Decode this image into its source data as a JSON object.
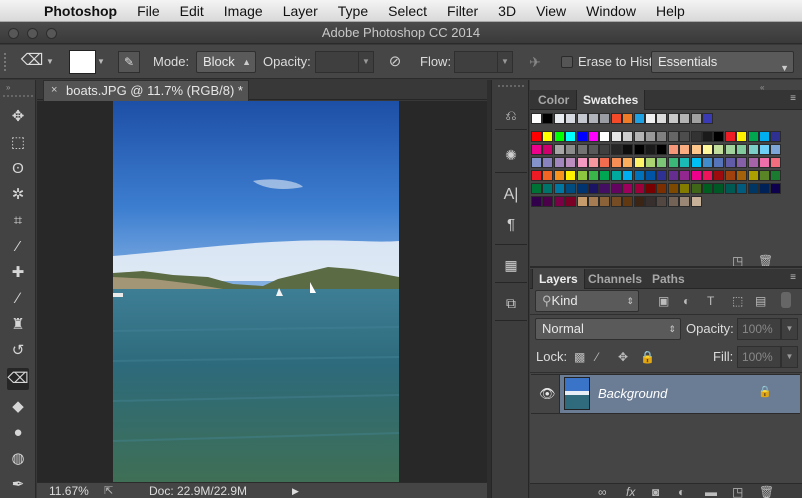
{
  "menubar": {
    "app_name": "Photoshop",
    "items": [
      "File",
      "Edit",
      "Image",
      "Layer",
      "Type",
      "Select",
      "Filter",
      "3D",
      "View",
      "Window",
      "Help"
    ]
  },
  "window": {
    "title": "Adobe Photoshop CC 2014"
  },
  "options": {
    "mode_label": "Mode:",
    "mode_value": "Block",
    "opacity_label": "Opacity:",
    "flow_label": "Flow:",
    "erase_history_label": "Erase to Hist",
    "workspace_value": "Essentials"
  },
  "document": {
    "tab_title": "boats.JPG @ 11.7% (RGB/8) *",
    "zoom": "11.67%",
    "doc_info": "Doc: 22.9M/22.9M"
  },
  "color_panel": {
    "tabs": [
      "Color",
      "Swatches"
    ],
    "active_tab": "Swatches"
  },
  "layers_panel": {
    "tabs": [
      "Layers",
      "Channels",
      "Paths"
    ],
    "filter_value": "Kind",
    "blend_mode": "Normal",
    "opacity_label": "Opacity:",
    "opacity_value": "100%",
    "lock_label": "Lock:",
    "fill_label": "Fill:",
    "fill_value": "100%",
    "layer_name": "Background"
  },
  "colors": {
    "selected_layer": "#6b7d94",
    "panel": "#454545"
  },
  "swatch_rows": [
    [
      "#ffffff",
      "#000000",
      "#e9ecf0",
      "#d6d9df",
      "#c5c8ce",
      "#b0b3ba",
      "#9a9da4",
      "#f44a2a",
      "#ed7b27",
      "#1fa2e4",
      "#f0f0f0",
      "#dcdcdc",
      "#c8c8c8",
      "#b4b4b4",
      "#a0a0a0",
      "#3a3ab4"
    ],
    [
      "#ff0000",
      "#ffff00",
      "#00ff00",
      "#00ffff",
      "#0000ff",
      "#ff00ff",
      "#ffffff",
      "#e6e6e6",
      "#cccccc",
      "#b3b3b3",
      "#999999",
      "#808080",
      "#666666",
      "#4d4d4d",
      "#333333",
      "#1a1a1a",
      "#000000",
      "#ee1c24",
      "#fff200",
      "#00a650",
      "#00aeef",
      "#2e3192"
    ],
    [
      "#ec008c",
      "#cd006d",
      "#a7a7a7",
      "#8c8c8c",
      "#737373",
      "#595959",
      "#404040",
      "#262626",
      "#0d0d0d",
      "#000000",
      "#1a1a1a",
      "#000000",
      "#f7977a",
      "#f9ad81",
      "#fdc68a",
      "#fff79a",
      "#c4df9b",
      "#a3d39c",
      "#82ca9d",
      "#7bcdc8",
      "#6ecff6",
      "#7ea7d8"
    ],
    [
      "#8493ca",
      "#8882be",
      "#a187be",
      "#bc8dbf",
      "#f49ac2",
      "#f6989d",
      "#f26c4f",
      "#f68e55",
      "#fbaf5c",
      "#fff467",
      "#acd372",
      "#7cc576",
      "#3bb878",
      "#1abbb4",
      "#00bff3",
      "#438ccb",
      "#5574b9",
      "#605ca8",
      "#855fa8",
      "#a763a8",
      "#f06eaa",
      "#f26d7d"
    ],
    [
      "#ed1c24",
      "#f26522",
      "#f7941d",
      "#fff200",
      "#8dc63f",
      "#39b54a",
      "#00a651",
      "#00a99d",
      "#00aeef",
      "#0072bc",
      "#0054a6",
      "#2e3192",
      "#662d91",
      "#92278f",
      "#ec008c",
      "#ed145b",
      "#9e0b0f",
      "#a0410d",
      "#a36209",
      "#aba000",
      "#598527",
      "#1a7b30"
    ],
    [
      "#007236",
      "#00746b",
      "#0076a3",
      "#004b80",
      "#003471",
      "#1b1464",
      "#440e62",
      "#630460",
      "#9e005d",
      "#9e0039",
      "#790000",
      "#7b2e00",
      "#7d4900",
      "#827b00",
      "#406618",
      "#005e20",
      "#005826",
      "#005952",
      "#005b7f",
      "#003663",
      "#002157",
      "#0d004c"
    ],
    [
      "#32004b",
      "#4b0049",
      "#7b0046",
      "#7a0026",
      "#c69c6d",
      "#a67c52",
      "#8c6239",
      "#754c24",
      "#603913",
      "#3c2415",
      "#362f2d",
      "#534741",
      "#736357",
      "#998675",
      "#c7b299"
    ]
  ]
}
